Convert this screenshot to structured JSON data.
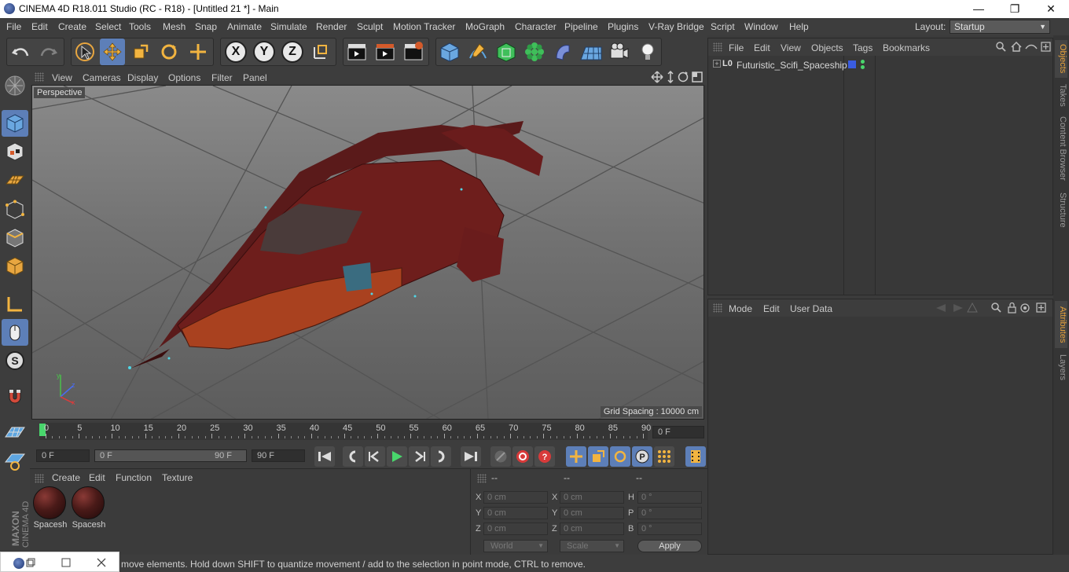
{
  "window": {
    "title": "CINEMA 4D R18.011 Studio (RC - R18) - [Untitled 21 *] - Main",
    "minimize": "—",
    "restore": "❐",
    "close": "✕"
  },
  "menubar": {
    "items": [
      "File",
      "Edit",
      "Create",
      "Select",
      "Tools",
      "Mesh",
      "Snap",
      "Animate",
      "Simulate",
      "Render",
      "Sculpt",
      "Motion Tracker",
      "MoGraph",
      "Character",
      "Pipeline",
      "Plugins",
      "V-Ray Bridge",
      "Script",
      "Window",
      "Help"
    ],
    "layout_label": "Layout:",
    "layout_value": "Startup"
  },
  "viewport": {
    "menu": [
      "View",
      "Cameras",
      "Display",
      "Options",
      "Filter",
      "Panel"
    ],
    "camera_label": "Perspective",
    "grid_spacing": "Grid Spacing : 10000 cm"
  },
  "timeline": {
    "ticks": [
      "0",
      "5",
      "10",
      "15",
      "20",
      "25",
      "30",
      "35",
      "40",
      "45",
      "50",
      "55",
      "60",
      "65",
      "70",
      "75",
      "80",
      "85",
      "90"
    ],
    "current_frame": "0 F"
  },
  "transport": {
    "start": "0 F",
    "range_start": "0 F",
    "range_end": "90 F",
    "end": "90 F"
  },
  "materials": {
    "menu": [
      "Create",
      "Edit",
      "Function",
      "Texture"
    ],
    "items": [
      "Spacesh",
      "Spacesh"
    ]
  },
  "coords": {
    "headers": [
      "--",
      "--",
      "--"
    ],
    "rows": [
      {
        "l1": "X",
        "v1": "0 cm",
        "l2": "X",
        "v2": "0 cm",
        "l3": "H",
        "v3": "0 °"
      },
      {
        "l1": "Y",
        "v1": "0 cm",
        "l2": "Y",
        "v2": "0 cm",
        "l3": "P",
        "v3": "0 °"
      },
      {
        "l1": "Z",
        "v1": "0 cm",
        "l2": "Z",
        "v2": "0 cm",
        "l3": "B",
        "v3": "0 °"
      }
    ],
    "world": "World",
    "scale": "Scale",
    "apply": "Apply"
  },
  "objects": {
    "menu": [
      "File",
      "Edit",
      "View",
      "Objects",
      "Tags",
      "Bookmarks"
    ],
    "tree": [
      {
        "name": "Futuristic_Scifi_Spaceship",
        "layer_icon": "L0"
      }
    ]
  },
  "attributes": {
    "menu": [
      "Mode",
      "Edit",
      "User Data"
    ]
  },
  "sidetabs": {
    "top": [
      "Objects",
      "Takes",
      "Content Browser",
      "Structure"
    ],
    "bottom": [
      "Attributes",
      "Layers"
    ]
  },
  "branding": {
    "maxon": "MAXON",
    "cinema": "CINEMA 4D"
  },
  "status": {
    "text": "move elements. Hold down SHIFT to quantize movement / add to the selection in point mode, CTRL to remove."
  },
  "colors": {
    "accent": "#5d7fb8",
    "tab_active": "#e6a23c",
    "ship_red": "#6e1e1c"
  }
}
